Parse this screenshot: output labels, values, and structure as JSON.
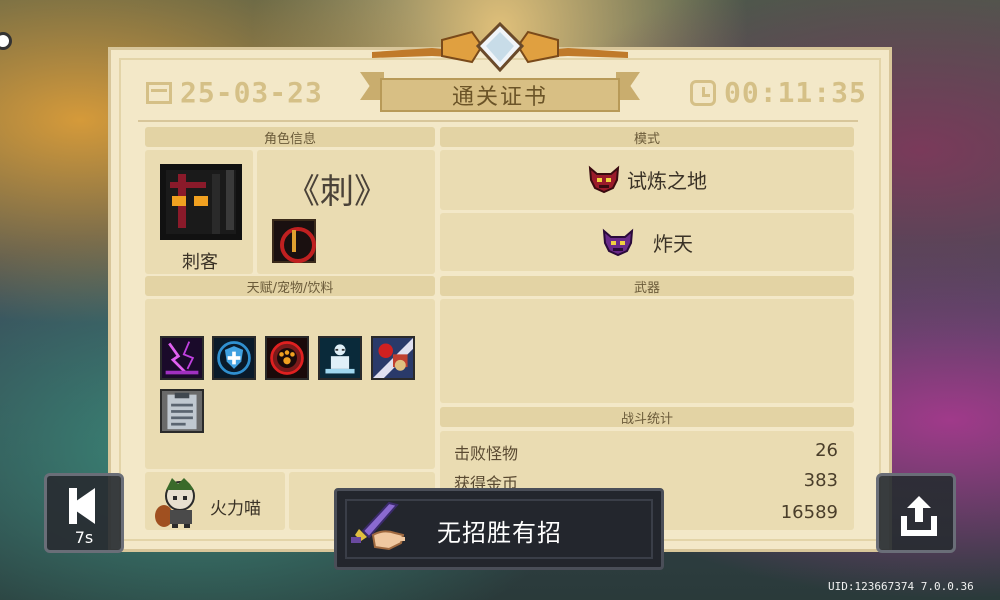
{
  "certificate": {
    "title": "通关证书",
    "date": "25-03-23",
    "time": "00:11:35"
  },
  "sections": {
    "character_info": "角色信息",
    "mode": "模式",
    "talents": "天赋/宠物/饮料",
    "weapons": "武器",
    "battle_stats": "战斗统计"
  },
  "character": {
    "class": "刺客",
    "name": "《刺》",
    "portrait_icon": "assassin-portrait-icon",
    "skill_icon": "assassin-skill-icon"
  },
  "modes": [
    {
      "label": "试炼之地",
      "icon": "trial-demon-icon"
    },
    {
      "label": "炸天",
      "icon": "purple-demon-icon"
    }
  ],
  "talents": [
    {
      "icon": "lightning-talent-icon"
    },
    {
      "icon": "shield-talent-icon"
    },
    {
      "icon": "paw-talent-icon"
    },
    {
      "icon": "statue-talent-icon"
    },
    {
      "icon": "boxing-talent-icon"
    },
    {
      "icon": "clipboard-talent-icon"
    }
  ],
  "pet": {
    "name": "火力喵",
    "icon": "fire-cat-pet-icon"
  },
  "stats": [
    {
      "label": "击败怪物",
      "value": "26"
    },
    {
      "label": "获得金币",
      "value": "383"
    },
    {
      "label": "",
      "value": "16589"
    }
  ],
  "back_button": {
    "timer": "7s"
  },
  "achievement": {
    "text": "无招胜有招",
    "icon": "sword-hand-icon"
  },
  "uid_text": "UID:123667374 7.0.0.36",
  "colors": {
    "panel_bg": "#f3e8c8",
    "section_header": "#e3d3a4",
    "accent_gold": "#d5c087",
    "toast_bg": "#23262d"
  }
}
